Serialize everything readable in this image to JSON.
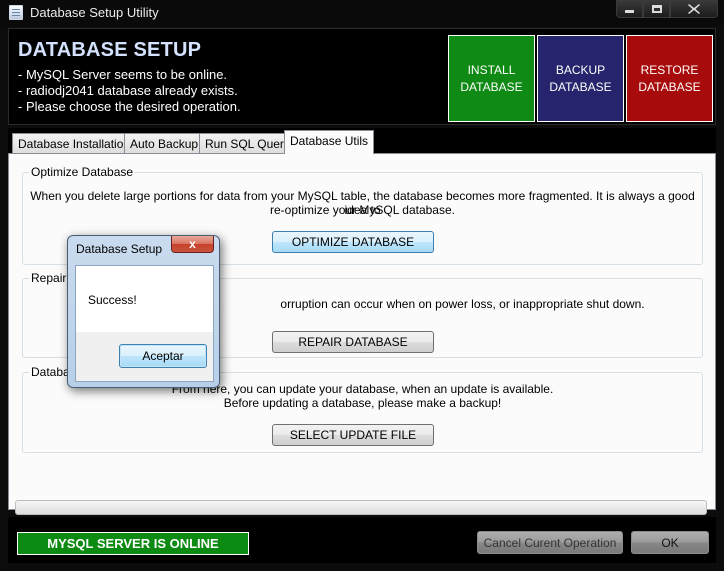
{
  "window": {
    "title": "Database Setup Utility",
    "icon": "database-window-icon",
    "controls": [
      "minimize",
      "maximize",
      "close"
    ]
  },
  "header": {
    "title": "DATABASE SETUP",
    "messages": [
      "- MySQL Server seems to be online.",
      "- radiodj2041 database already exists.",
      "- Please choose the desired operation."
    ],
    "actions": {
      "install": {
        "line1": "INSTALL",
        "line2": "DATABASE",
        "color": "#0f8a14"
      },
      "backup": {
        "line1": "BACKUP",
        "line2": "DATABASE",
        "color": "#26246c"
      },
      "restore": {
        "line1": "RESTORE",
        "line2": "DATABASE",
        "color": "#a80b0b"
      }
    }
  },
  "tabs": [
    {
      "label": "Database Installation"
    },
    {
      "label": "Auto Backup"
    },
    {
      "label": "Run SQL Query"
    },
    {
      "label": "Database Utils",
      "active": true
    }
  ],
  "utils": {
    "optimize": {
      "legend": "Optimize Database",
      "desc_line1": "When you delete large portions for data from your MySQL table, the database becomes more fragmented. It is always a good idea to",
      "desc_line2": "re-optimize your MySQL database.",
      "button": "OPTIMIZE DATABASE"
    },
    "repair": {
      "legend": "Repair D",
      "desc_line1": "orruption can occur when on power loss, or inappropriate shut down.",
      "button": "REPAIR DATABASE"
    },
    "update": {
      "legend": "Databa",
      "desc_line1": "From here, you can update your database, when an update is available.",
      "desc_line2": "Before updating a database, please make a backup!",
      "button": "SELECT UPDATE FILE"
    }
  },
  "progress": {
    "value": 0
  },
  "footer": {
    "status": "MYSQL SERVER IS ONLINE",
    "status_color": "#0d8a11",
    "cancel": "Cancel Curent Operation",
    "ok": "OK"
  },
  "dialog": {
    "title": "Database Setup",
    "message": "Success!",
    "button": "Aceptar",
    "close_glyph": "x"
  }
}
